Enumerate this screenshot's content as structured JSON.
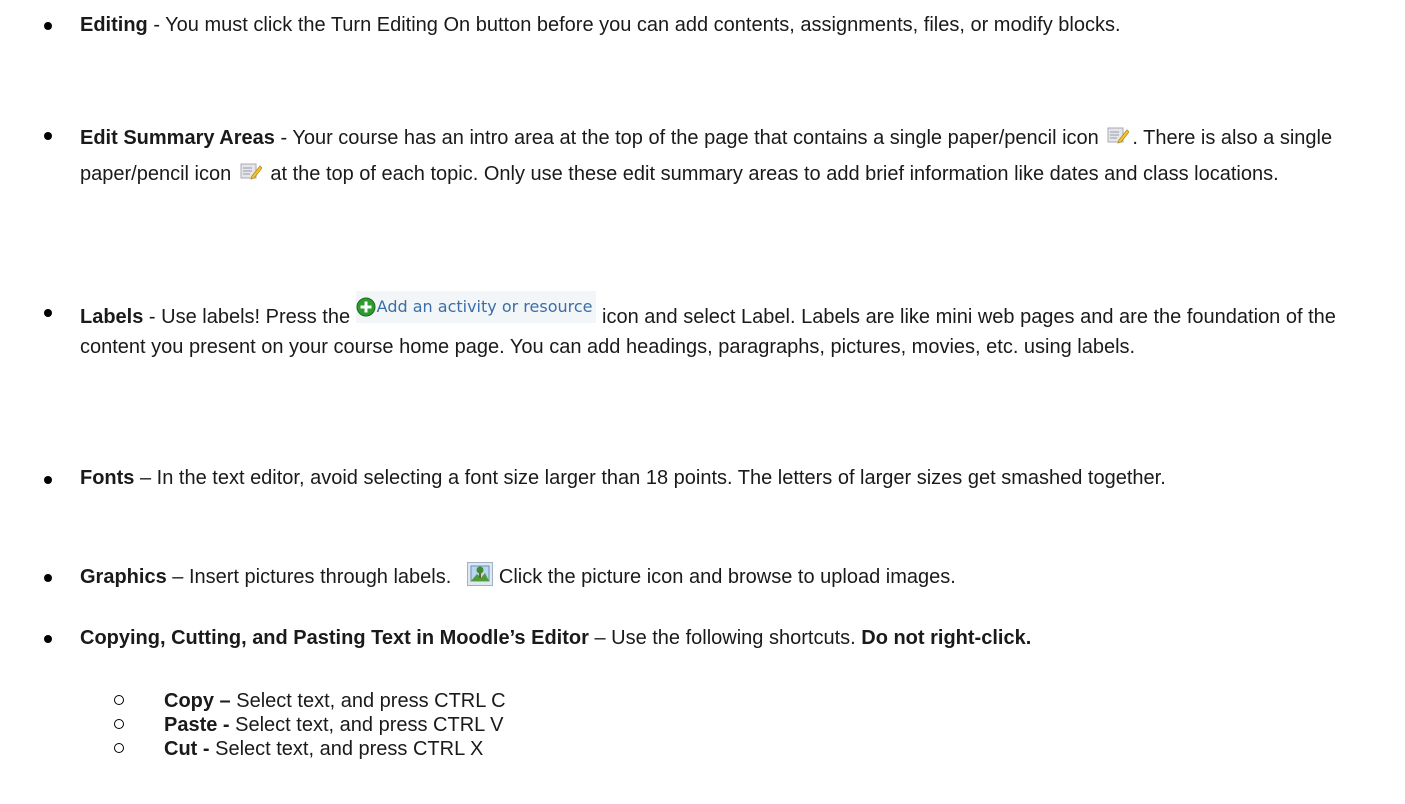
{
  "items": [
    {
      "id": "editing",
      "title": "Editing",
      "text": " - You must click the Turn Editing On button before you can add contents, assignments, files, or modify blocks."
    },
    {
      "id": "summary",
      "title": "Edit Summary Areas",
      "text_a": " - Your course has an intro area at the top of the page that contains a single paper/pencil icon",
      "text_b": ". There is also a single paper/pencil icon",
      "text_c": "at the top of each topic.  Only use these edit summary areas to add brief information like dates and class locations."
    },
    {
      "id": "labels",
      "title": "Labels",
      "text_a": " - Use labels!  Press the",
      "button_label": "Add an activity or resource",
      "text_b": "icon and select Label.  Labels are like mini web pages and are the foundation of the content you present on your course home page. You can add headings, paragraphs, pictures, movies, etc. using labels."
    },
    {
      "id": "fonts",
      "title": "Fonts",
      "text": " – In the text editor, avoid selecting a font size larger than 18 points. The letters of larger sizes get smashed together."
    },
    {
      "id": "graphics",
      "title": "Graphics",
      "text_a": " – Insert pictures through labels.",
      "text_b": "Click the picture icon and browse to upload images."
    },
    {
      "id": "copying",
      "title": "Copying, Cutting, and Pasting Text in Moodle’s Editor",
      "text": " – Use the following shortcuts. ",
      "emphasis": "Do not right-click."
    }
  ],
  "shortcuts": [
    {
      "title": "Copy –",
      "text": " Select text, and press CTRL C"
    },
    {
      "title": "Paste -",
      "text": " Select text, and press CTRL V"
    },
    {
      "title": "Cut -",
      "text": " Select text, and press CTRL X"
    }
  ],
  "icons": {
    "pencil": "paper-pencil-icon",
    "add": "add-activity-plus-icon",
    "picture": "picture-icon"
  },
  "colors": {
    "add_icon": "#2e9b2e",
    "add_text": "#3b6ea5"
  }
}
